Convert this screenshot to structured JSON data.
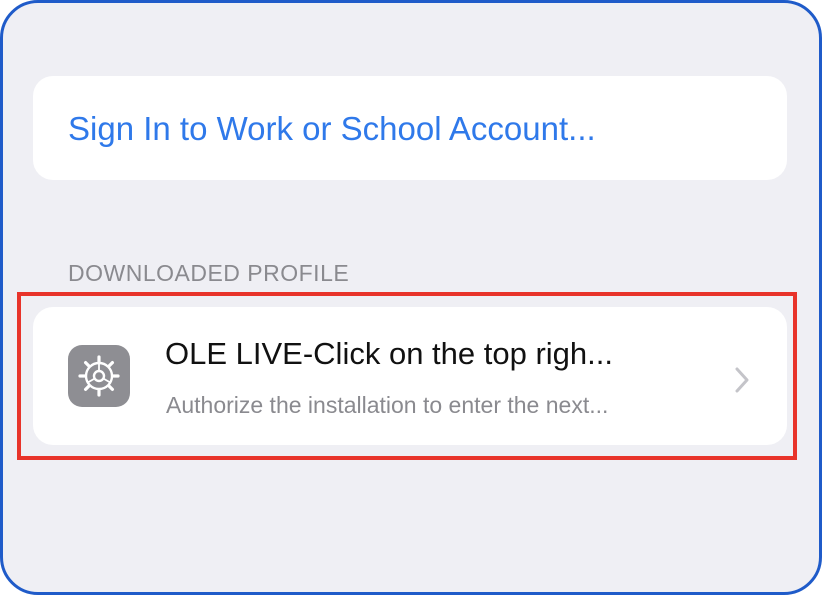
{
  "sign_in": {
    "label": "Sign In to Work or School Account..."
  },
  "downloaded_profile_section": {
    "header": "DOWNLOADED PROFILE",
    "profile": {
      "icon": "settings-gear-icon",
      "title": "OLE LIVE-Click on the top righ...",
      "subtitle": "Authorize the installation to enter the next..."
    }
  },
  "colors": {
    "accent_link": "#2f79ea",
    "highlight_box": "#e8332a",
    "frame_border": "#1f5bc9",
    "background": "#efeff4",
    "icon_gray": "#8e8e93"
  }
}
